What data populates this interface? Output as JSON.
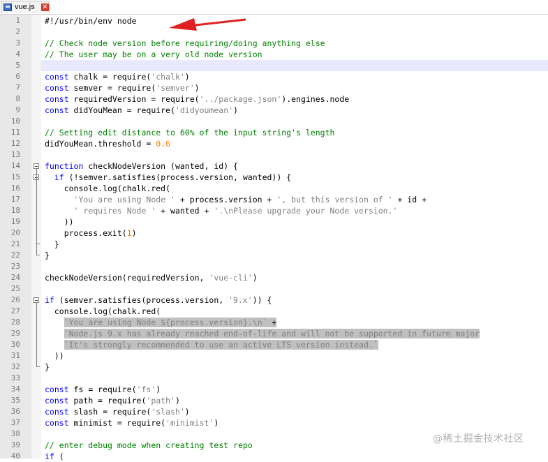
{
  "tab": {
    "label": "vue.js",
    "icon": "file-save-icon",
    "close_icon": "close-icon"
  },
  "colors": {
    "keyword": "#0000ff",
    "comment": "#008000",
    "string": "#808080",
    "number": "#ff8000",
    "current_line": "#e8e8ff",
    "selection": "#c0c0c0",
    "annotation_arrow": "#e02020"
  },
  "current_line": 5,
  "selected_lines": [
    28,
    29,
    30
  ],
  "fold_markers": [
    14,
    15,
    26
  ],
  "lines": [
    {
      "n": "1",
      "t": [
        [
          "",
          "#!/usr/bin/env node"
        ]
      ]
    },
    {
      "n": "2",
      "t": []
    },
    {
      "n": "3",
      "t": [
        [
          "cm",
          "// Check node version before requiring/doing anything else"
        ]
      ]
    },
    {
      "n": "4",
      "t": [
        [
          "cm",
          "// The user may be on a very old node version"
        ]
      ]
    },
    {
      "n": "5",
      "t": []
    },
    {
      "n": "6",
      "t": [
        [
          "kw",
          "const"
        ],
        [
          "",
          " chalk = require("
        ],
        [
          "str",
          "'chalk'"
        ],
        [
          "",
          ")"
        ]
      ]
    },
    {
      "n": "7",
      "t": [
        [
          "kw",
          "const"
        ],
        [
          "",
          " semver = require("
        ],
        [
          "str",
          "'semver'"
        ],
        [
          "",
          ")"
        ]
      ]
    },
    {
      "n": "8",
      "t": [
        [
          "kw",
          "const"
        ],
        [
          "",
          " requiredVersion = require("
        ],
        [
          "str",
          "'../package.json'"
        ],
        [
          "",
          ").engines.node"
        ]
      ]
    },
    {
      "n": "9",
      "t": [
        [
          "kw",
          "const"
        ],
        [
          "",
          " didYouMean = require("
        ],
        [
          "str",
          "'didyoumean'"
        ],
        [
          "",
          ")"
        ]
      ]
    },
    {
      "n": "10",
      "t": []
    },
    {
      "n": "11",
      "t": [
        [
          "cm",
          "// Setting edit distance to 60% of the input string's length"
        ]
      ]
    },
    {
      "n": "12",
      "t": [
        [
          "",
          "didYouMean.threshold = "
        ],
        [
          "num",
          "0.6"
        ]
      ]
    },
    {
      "n": "13",
      "t": []
    },
    {
      "n": "14",
      "t": [
        [
          "kw",
          "function"
        ],
        [
          "",
          " checkNodeVersion (wanted, id) {"
        ]
      ]
    },
    {
      "n": "15",
      "t": [
        [
          "",
          "  "
        ],
        [
          "kw",
          "if"
        ],
        [
          "",
          " (!semver.satisfies(process.version, wanted)) {"
        ]
      ]
    },
    {
      "n": "16",
      "t": [
        [
          "",
          "    console.log(chalk.red("
        ]
      ]
    },
    {
      "n": "17",
      "t": [
        [
          "",
          "      "
        ],
        [
          "str",
          "'You are using Node '"
        ],
        [
          "",
          " + process.version + "
        ],
        [
          "str",
          "', but this version of '"
        ],
        [
          "",
          " + id +"
        ]
      ]
    },
    {
      "n": "18",
      "t": [
        [
          "",
          "      "
        ],
        [
          "str",
          "' requires Node '"
        ],
        [
          "",
          " + wanted + "
        ],
        [
          "str",
          "'.\\nPlease upgrade your Node version.'"
        ]
      ]
    },
    {
      "n": "19",
      "t": [
        [
          "",
          "    ))"
        ]
      ]
    },
    {
      "n": "20",
      "t": [
        [
          "",
          "    process.exit("
        ],
        [
          "num",
          "1"
        ],
        [
          "",
          ")"
        ]
      ]
    },
    {
      "n": "21",
      "t": [
        [
          "",
          "  }"
        ]
      ]
    },
    {
      "n": "22",
      "t": [
        [
          "",
          "}"
        ]
      ]
    },
    {
      "n": "23",
      "t": []
    },
    {
      "n": "24",
      "t": [
        [
          "",
          "checkNodeVersion(requiredVersion, "
        ],
        [
          "str",
          "'vue-cli'"
        ],
        [
          "",
          ")"
        ]
      ]
    },
    {
      "n": "25",
      "t": []
    },
    {
      "n": "26",
      "t": [
        [
          "kw",
          "if"
        ],
        [
          "",
          " (semver.satisfies(process.version, "
        ],
        [
          "str",
          "'9.x'"
        ],
        [
          "",
          ")) {"
        ]
      ]
    },
    {
      "n": "27",
      "t": [
        [
          "",
          "  console.log(chalk.red("
        ]
      ]
    },
    {
      "n": "28",
      "t": [
        [
          "",
          "    "
        ],
        [
          "str",
          "`You are using Node ${process.version}.\\n`"
        ],
        [
          "",
          " +"
        ]
      ]
    },
    {
      "n": "29",
      "t": [
        [
          "",
          "    "
        ],
        [
          "str",
          "`Node.js 9.x has already reached end-of-life and will not be supported in future major"
        ]
      ]
    },
    {
      "n": "30",
      "t": [
        [
          "",
          "    "
        ],
        [
          "str",
          "`It's strongly recommended to use an active LTS version instead.`"
        ]
      ]
    },
    {
      "n": "31",
      "t": [
        [
          "",
          "  ))"
        ]
      ]
    },
    {
      "n": "32",
      "t": [
        [
          "",
          "}"
        ]
      ]
    },
    {
      "n": "33",
      "t": []
    },
    {
      "n": "34",
      "t": [
        [
          "kw",
          "const"
        ],
        [
          "",
          " fs = require("
        ],
        [
          "str",
          "'fs'"
        ],
        [
          "",
          ")"
        ]
      ]
    },
    {
      "n": "35",
      "t": [
        [
          "kw",
          "const"
        ],
        [
          "",
          " path = require("
        ],
        [
          "str",
          "'path'"
        ],
        [
          "",
          ")"
        ]
      ]
    },
    {
      "n": "36",
      "t": [
        [
          "kw",
          "const"
        ],
        [
          "",
          " slash = require("
        ],
        [
          "str",
          "'slash'"
        ],
        [
          "",
          ")"
        ]
      ]
    },
    {
      "n": "37",
      "t": [
        [
          "kw",
          "const"
        ],
        [
          "",
          " minimist = require("
        ],
        [
          "str",
          "'minimist'"
        ],
        [
          "",
          ")"
        ]
      ]
    },
    {
      "n": "38",
      "t": []
    },
    {
      "n": "39",
      "t": [
        [
          "cm",
          "// enter debug mode when creating test repo"
        ]
      ]
    },
    {
      "n": "40",
      "t": [
        [
          "kw",
          "if"
        ],
        [
          "",
          " ("
        ]
      ]
    }
  ],
  "watermark": "@稀土掘金技术社区"
}
